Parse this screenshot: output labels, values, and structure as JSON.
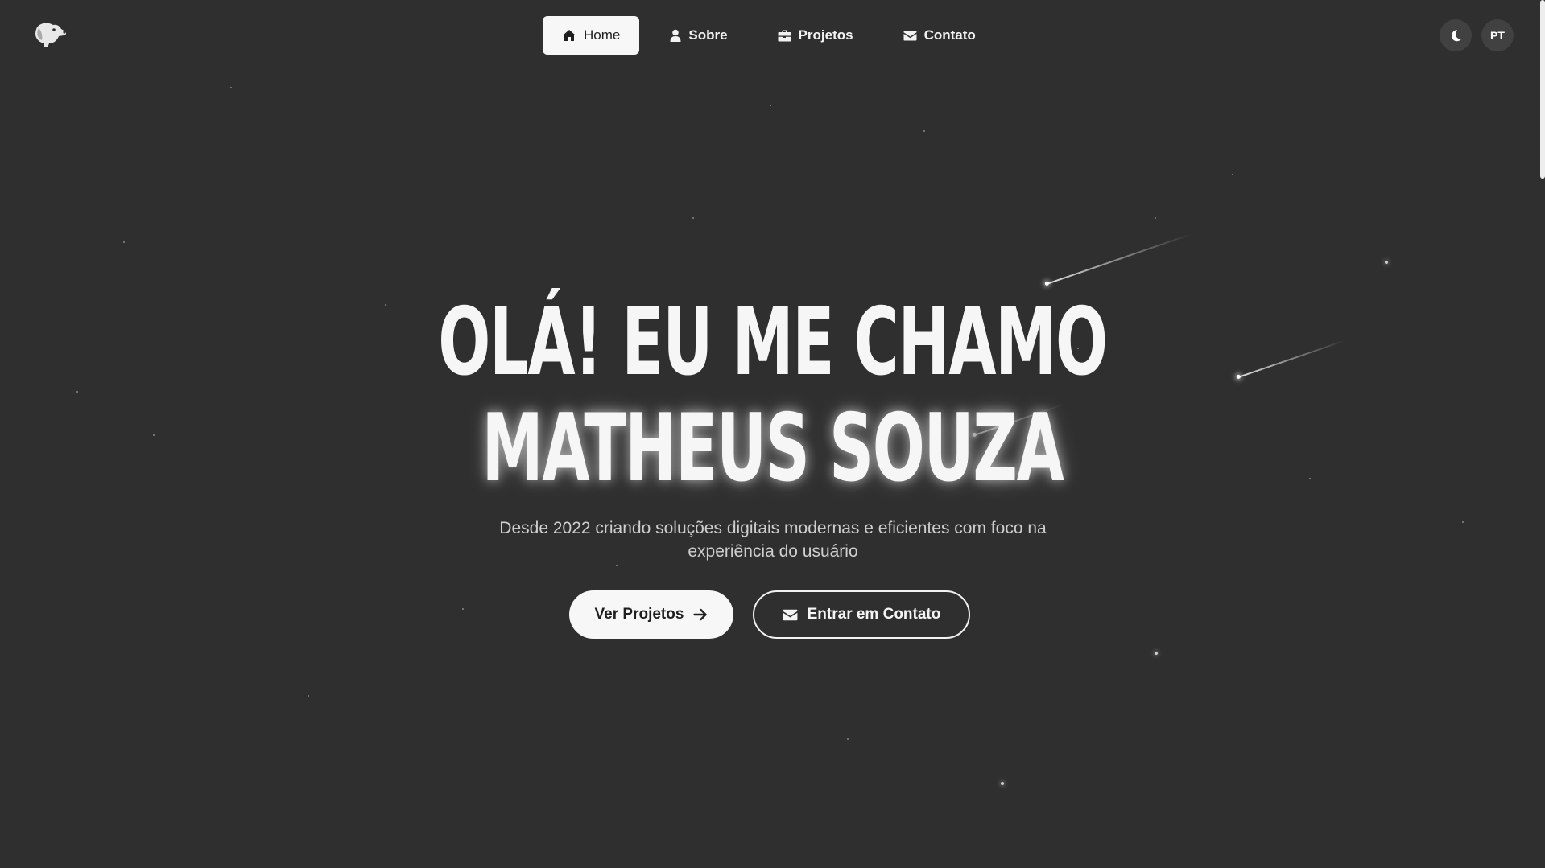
{
  "header": {
    "logo_icon": "dog-head-icon",
    "nav": [
      {
        "label": "Home",
        "icon": "home-icon",
        "active": true
      },
      {
        "label": "Sobre",
        "icon": "user-icon",
        "active": false
      },
      {
        "label": "Projetos",
        "icon": "briefcase-icon",
        "active": false
      },
      {
        "label": "Contato",
        "icon": "envelope-icon",
        "active": false
      }
    ],
    "theme_toggle_icon": "moon-icon",
    "language_label": "PT"
  },
  "hero": {
    "title_line1": "OLÁ! EU ME CHAMO",
    "title_line2": "MATHEUS SOUZA",
    "subtitle": "Desde 2022 criando soluções digitais modernas e eficientes com foco na experiência do usuário",
    "primary_button": {
      "label": "Ver Projetos",
      "icon": "arrow-right-icon"
    },
    "secondary_button": {
      "label": "Entrar em Contato",
      "icon": "envelope-icon"
    }
  },
  "colors": {
    "background": "#2f2f2f",
    "surface_button": "#414141",
    "text_primary": "#f6f6f6",
    "text_secondary": "#cfcfcf",
    "active_nav_bg": "#f7f7f7"
  }
}
